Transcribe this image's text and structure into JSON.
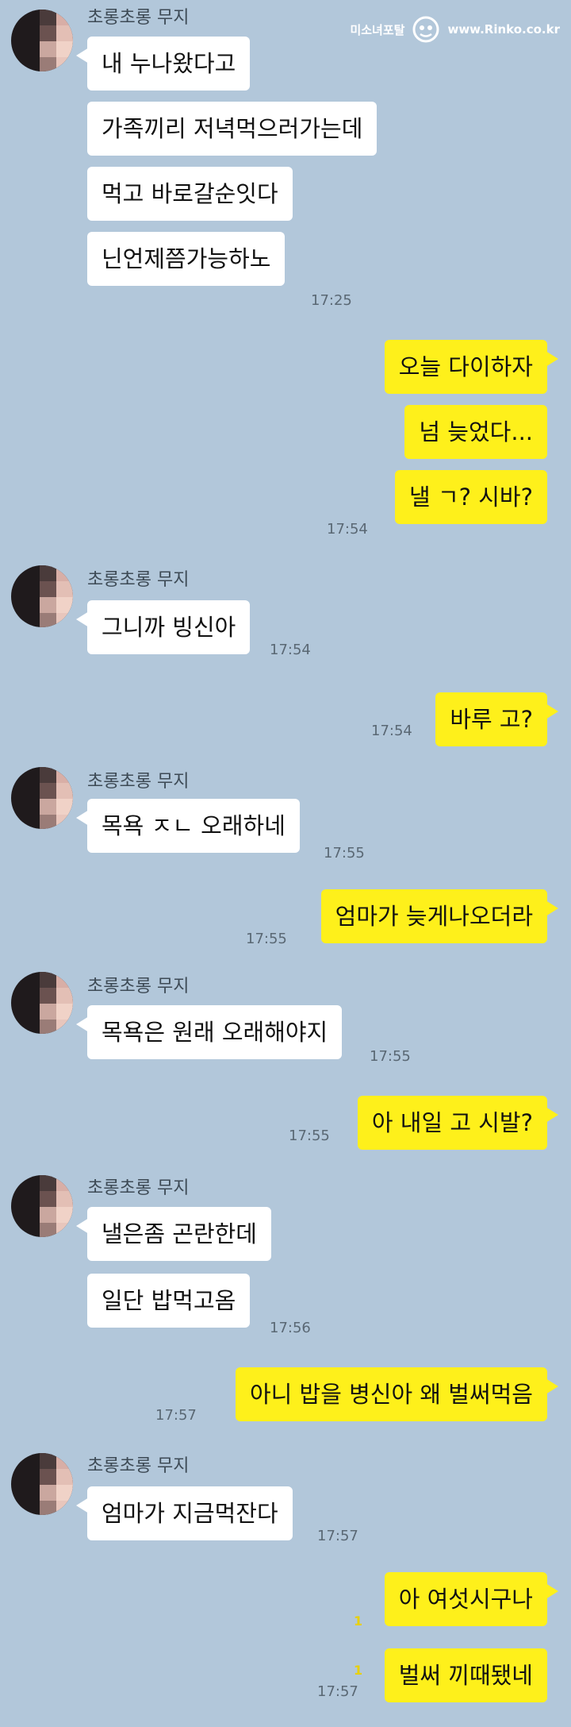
{
  "watermark": {
    "site": "미소녀포탈",
    "url": "www.Rinko.co.kr"
  },
  "sender_name": "초롱초롱 무지",
  "conversation": [
    {
      "from": "friend",
      "text": "내 누나왔다고"
    },
    {
      "from": "friend",
      "text": "가족끼리 저녁먹으러가는데"
    },
    {
      "from": "friend",
      "text": "먹고 바로갈순잇다"
    },
    {
      "from": "friend",
      "text": "닌언제쯤가능하노",
      "time": "17:25"
    },
    {
      "from": "me",
      "text": "오늘 다이하자"
    },
    {
      "from": "me",
      "text": "넘 늦었다..."
    },
    {
      "from": "me",
      "text": "낼 ㄱ? 시바?",
      "time": "17:54"
    },
    {
      "from": "friend",
      "text": "그니까 빙신아",
      "time": "17:54"
    },
    {
      "from": "me",
      "text": "바루 고?",
      "time": "17:54"
    },
    {
      "from": "friend",
      "text": "목욕 ㅈㄴ 오래하네",
      "time": "17:55"
    },
    {
      "from": "me",
      "text": "엄마가 늦게나오더라",
      "time": "17:55"
    },
    {
      "from": "friend",
      "text": "목욕은 원래 오래해야지",
      "time": "17:55"
    },
    {
      "from": "me",
      "text": "아 내일 고 시발?",
      "time": "17:55"
    },
    {
      "from": "friend",
      "text": "낼은좀 곤란한데"
    },
    {
      "from": "friend",
      "text": "일단 밥먹고옴",
      "time": "17:56"
    },
    {
      "from": "me",
      "text": "아니 밥을 병신아 왜 벌써먹음",
      "time": "17:57"
    },
    {
      "from": "friend",
      "text": "엄마가 지금먹잔다",
      "time": "17:57"
    },
    {
      "from": "me",
      "text": "아 여섯시구나",
      "unread": "1"
    },
    {
      "from": "me",
      "text": "벌써 끼때됐네",
      "unread": "1",
      "time": "17:57"
    }
  ]
}
